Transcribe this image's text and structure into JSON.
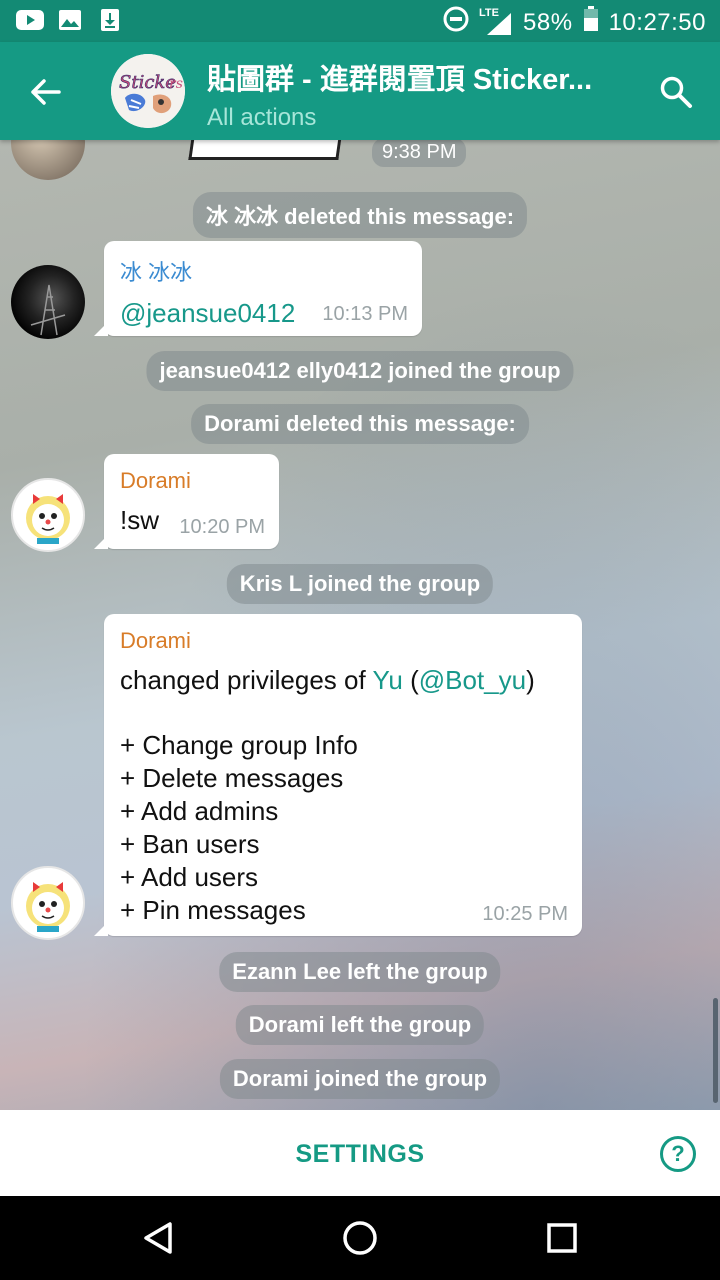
{
  "status_bar": {
    "battery": "58%",
    "time": "10:27:50",
    "network": "LTE",
    "icons": [
      "youtube-icon",
      "gallery-icon",
      "download-icon",
      "dnd-icon",
      "signal-icon",
      "battery-icon"
    ]
  },
  "app_bar": {
    "title": "貼圖群 - 進群閱置頂 Sticker...",
    "subtitle": "All actions",
    "avatar_text": "Stickers"
  },
  "chat": {
    "top_time": "9:38 PM",
    "sys1": "冰 冰冰 deleted this message:",
    "msg1": {
      "sender": "冰 冰冰",
      "text": "@jeansue0412",
      "time": "10:13 PM"
    },
    "sys2": "jeansue0412 elly0412 joined the group",
    "sys3": "Dorami deleted this message:",
    "msg2": {
      "sender": "Dorami",
      "text": "!sw",
      "time": "10:20 PM"
    },
    "sys4": "Kris L joined the group",
    "msg3": {
      "sender": "Dorami",
      "line1_prefix": "changed privileges of ",
      "line1_name": "Yu",
      "line1_paren_open": " (",
      "line1_handle": "@Bot_yu",
      "line1_paren_close": ")",
      "privileges": [
        "+ Change group Info",
        "+ Delete messages",
        "+ Add admins",
        "+ Ban users",
        "+ Add users",
        "+ Pin messages"
      ],
      "time": "10:25 PM"
    },
    "sys5": "Ezann Lee left the group",
    "sys6": "Dorami left the group",
    "sys7": "Dorami joined the group"
  },
  "bottom_bar": {
    "settings_label": "SETTINGS",
    "help_label": "?"
  },
  "colors": {
    "primary": "#159a84",
    "status": "#138a74",
    "link": "#17988a",
    "sender_blue": "#3b8bd1",
    "sender_orange": "#d87c28"
  }
}
